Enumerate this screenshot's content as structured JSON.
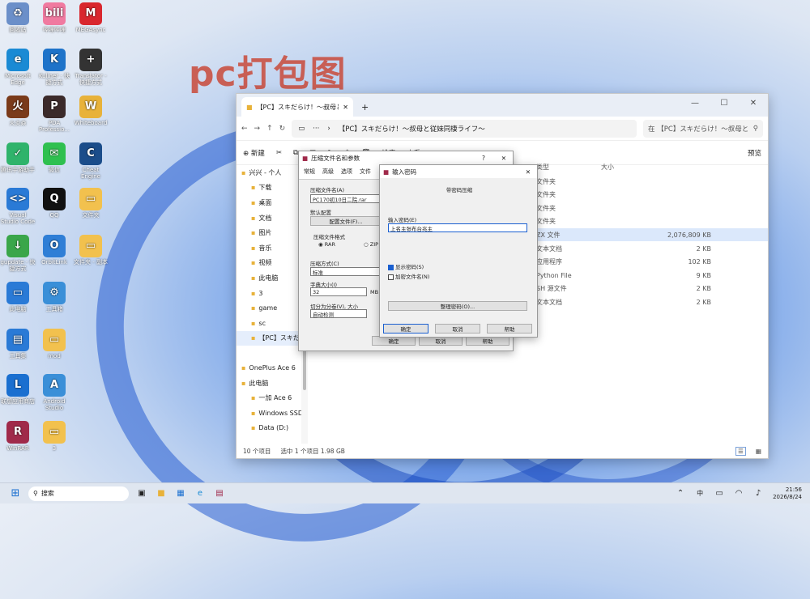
{
  "watermark": "pc打包图",
  "desktop": [
    {
      "label": "回收站",
      "color": "#6b8fc9",
      "glyph": "♻"
    },
    {
      "label": "哔哩哔哩",
      "color": "#f07aa0",
      "glyph": "bili"
    },
    {
      "label": "MEGAsync",
      "color": "#d9272e",
      "glyph": "M"
    },
    {
      "label": "Microsoft Edge",
      "color": "#1a8ad4",
      "glyph": "e"
    },
    {
      "label": "Kuliner - 快捷方式",
      "color": "#1e73c9",
      "glyph": "K"
    },
    {
      "label": "Translator - 快捷方式",
      "color": "#333",
      "glyph": "+"
    },
    {
      "label": "火炎焱",
      "color": "#7a3a1a",
      "glyph": "火"
    },
    {
      "label": "PDA Professio...",
      "color": "#3b2a2a",
      "glyph": "P"
    },
    {
      "label": "Whiteboard",
      "color": "#e8b23a",
      "glyph": "W"
    },
    {
      "label": "腾讯手游助手",
      "color": "#2fb36b",
      "glyph": "✓"
    },
    {
      "label": "微信",
      "color": "#2fc04f",
      "glyph": "✉"
    },
    {
      "label": "Cheat Engine",
      "color": "#1b4d8a",
      "glyph": "C"
    },
    {
      "label": "Visual Studio Code",
      "color": "#2a7ad6",
      "glyph": "<>"
    },
    {
      "label": "QQ",
      "color": "#111",
      "glyph": "Q"
    },
    {
      "label": "文件夹",
      "color": "#f2c14e",
      "glyph": "▭"
    },
    {
      "label": "gupdate - 快捷方式",
      "color": "#3aa64a",
      "glyph": "↓"
    },
    {
      "label": "OrbitLink",
      "color": "#2f7ed6",
      "glyph": "O"
    },
    {
      "label": "文件夹 - 副本",
      "color": "#f2c14e",
      "glyph": "▭"
    },
    {
      "label": "此电脑",
      "color": "#2a7ad6",
      "glyph": "▭"
    },
    {
      "label": "工具箱",
      "color": "#3a8fd8",
      "glyph": "⚙"
    },
    {
      "label": "工具集",
      "color": "#2a7ad6",
      "glyph": "▤"
    },
    {
      "label": "mod",
      "color": "#f2c14e",
      "glyph": "▭"
    },
    {
      "label": "联想应用商店",
      "color": "#1a6fd0",
      "glyph": "L"
    },
    {
      "label": "Android Studio",
      "color": "#3a8fd8",
      "glyph": "A"
    },
    {
      "label": "WinRAR",
      "color": "#a02a4a",
      "glyph": "R"
    },
    {
      "label": "3",
      "color": "#f2c14e",
      "glyph": "▭"
    }
  ],
  "explorer": {
    "tab_title": "【PC】スキだらけ！～叔母と",
    "tab_close": "✕",
    "tab_add": "+",
    "controls": [
      "—",
      "☐",
      "✕"
    ],
    "address": "【PC】スキだらけ！～叔母と従妹同棲ライフ～",
    "address_more": "···",
    "address_arrow": "›",
    "search": "在 【PC】スキだらけ！～叔母と",
    "toolbar": {
      "new": "⊕ 新建",
      "sort": "排序",
      "view": "查看",
      "more": "···",
      "preview": "预览"
    },
    "nav": [
      "兴兴 - 个人",
      "下载",
      "桌面",
      "文档",
      "图片",
      "音乐",
      "视频",
      "此电脑",
      "3",
      "game",
      "sc",
      "【PC】スキだら",
      "OnePlus Ace 6",
      "此电脑",
      "一加 Ace 6",
      "Windows SSD",
      "Data (D:)"
    ],
    "header": {
      "type": "类型",
      "size": "大小"
    },
    "files": [
      {
        "type": "文件夹",
        "size": ""
      },
      {
        "type": "文件夹",
        "size": ""
      },
      {
        "type": "文件夹",
        "size": ""
      },
      {
        "type": "文件夹",
        "size": ""
      },
      {
        "type": "ZX 文件",
        "size": "2,076,809 KB"
      },
      {
        "type": "文本文档",
        "size": "2 KB"
      },
      {
        "type": "应用程序",
        "size": "102 KB"
      },
      {
        "type": "Python File",
        "size": "9 KB"
      },
      {
        "type": "SH 源文件",
        "size": "2 KB"
      },
      {
        "type": "文本文档",
        "size": "2 KB"
      }
    ],
    "status": {
      "count": "10 个项目",
      "selected": "选中 1 个项目 1.98 GB"
    }
  },
  "rar_dialog": {
    "title": "压缩文件名和参数",
    "tabs": [
      "常规",
      "高级",
      "选项",
      "文件"
    ],
    "archive_label": "压缩文件名(A)",
    "archive_value": "PC170初10日二院.rar",
    "profile_label": "默认配置",
    "profile_btn": "配置文件(F)...",
    "format_label": "压缩文件格式",
    "fmt_rar": "RAR",
    "fmt_zip": "ZIP",
    "method_label": "压缩方式(C)",
    "method_value": "标准",
    "dict_label": "字典大小(I)",
    "dict_value": "32",
    "dict_unit": "MB",
    "split_label": "切分为分卷(V), 大小",
    "split_value": "自动检测",
    "ok": "确定",
    "cancel": "取消",
    "help": "帮助"
  },
  "pwd_dialog": {
    "title": "输入密码",
    "heading": "带密码压缩",
    "label": "输入密码(E)",
    "value": "上名主张布台兆主",
    "show_pwd": "显示密码(S)",
    "encrypt_names": "加密文件名(N)",
    "organize": "整理密码(O)...",
    "ok": "确定",
    "cancel": "取消",
    "help": "帮助"
  },
  "taskbar": {
    "search": "搜索",
    "ime": "中",
    "time": "21:56",
    "date": "2026/8/24"
  }
}
